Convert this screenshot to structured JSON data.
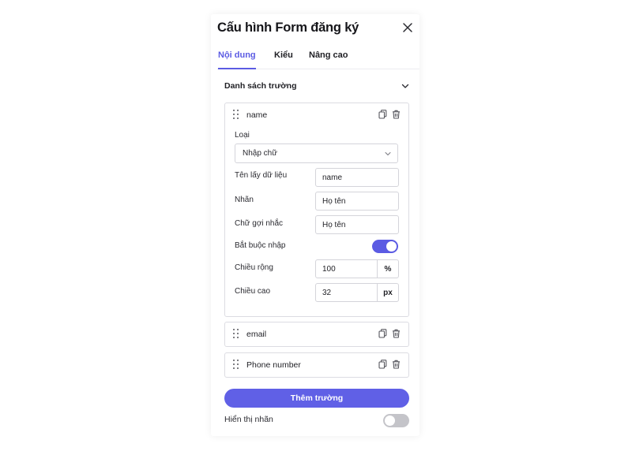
{
  "panel": {
    "title": "Cấu hình Form đăng ký"
  },
  "tabs": [
    {
      "label": "Nội dung",
      "active": true
    },
    {
      "label": "Kiểu",
      "active": false
    },
    {
      "label": "Nâng cao",
      "active": false
    }
  ],
  "section": {
    "title": "Danh sách trường"
  },
  "fields": [
    {
      "name": "name",
      "expanded": true,
      "type_label": "Loại",
      "type_value": "Nhập chữ",
      "key_label": "Tên lấy dữ liệu",
      "key_value": "name",
      "label_label": "Nhãn",
      "label_value": "Họ tên",
      "placeholder_label": "Chữ gợi nhắc",
      "placeholder_value": "Họ tên",
      "required_label": "Bắt buộc nhập",
      "required": true,
      "width_label": "Chiều rộng",
      "width_value": "100",
      "width_unit": "%",
      "height_label": "Chiều cao",
      "height_value": "32",
      "height_unit": "px"
    },
    {
      "name": "email",
      "expanded": false
    },
    {
      "name": "Phone number",
      "expanded": false
    }
  ],
  "add_button": {
    "label": "Thêm trường"
  },
  "show_label": {
    "label": "Hiển thị nhãn",
    "enabled": false
  },
  "colors": {
    "accent": "#5b5be3",
    "toggle_off": "#c4c4c9"
  },
  "icons": {
    "close": "close-icon",
    "chevron": "chevron-down-icon",
    "drag": "drag-handle-icon",
    "copy": "copy-icon",
    "trash": "trash-icon"
  }
}
